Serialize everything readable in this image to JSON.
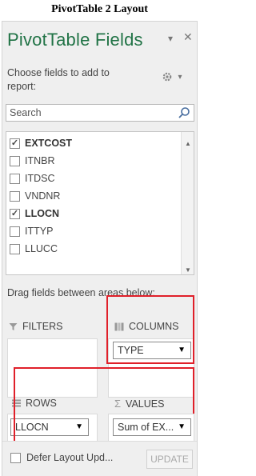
{
  "caption": "PivotTable 2 Layout",
  "pane": {
    "title": "PivotTable Fields",
    "choose_text": "Choose fields to add to report:",
    "search_placeholder": "Search",
    "accent_color": "#217346",
    "highlight_color": "#e0202a"
  },
  "fields": [
    {
      "label": "EXTCOST",
      "checked": true
    },
    {
      "label": "ITNBR",
      "checked": false
    },
    {
      "label": "ITDSC",
      "checked": false
    },
    {
      "label": "VNDNR",
      "checked": false
    },
    {
      "label": "LLOCN",
      "checked": true
    },
    {
      "label": "ITTYP",
      "checked": false
    },
    {
      "label": "LLUCC",
      "checked": false
    }
  ],
  "drag_text": "Drag fields between areas below:",
  "areas": {
    "filters": {
      "label": "FILTERS",
      "icon": "filter-icon"
    },
    "columns": {
      "label": "COLUMNS",
      "icon": "columns-icon",
      "items": [
        "TYPE"
      ]
    },
    "rows": {
      "label": "ROWS",
      "icon": "rows-icon",
      "items": [
        "LLOCN"
      ]
    },
    "values": {
      "label": "VALUES",
      "icon": "sigma-icon",
      "items": [
        "Sum of EX..."
      ]
    }
  },
  "footer": {
    "defer_label": "Defer Layout Upd...",
    "update_label": "UPDATE"
  }
}
